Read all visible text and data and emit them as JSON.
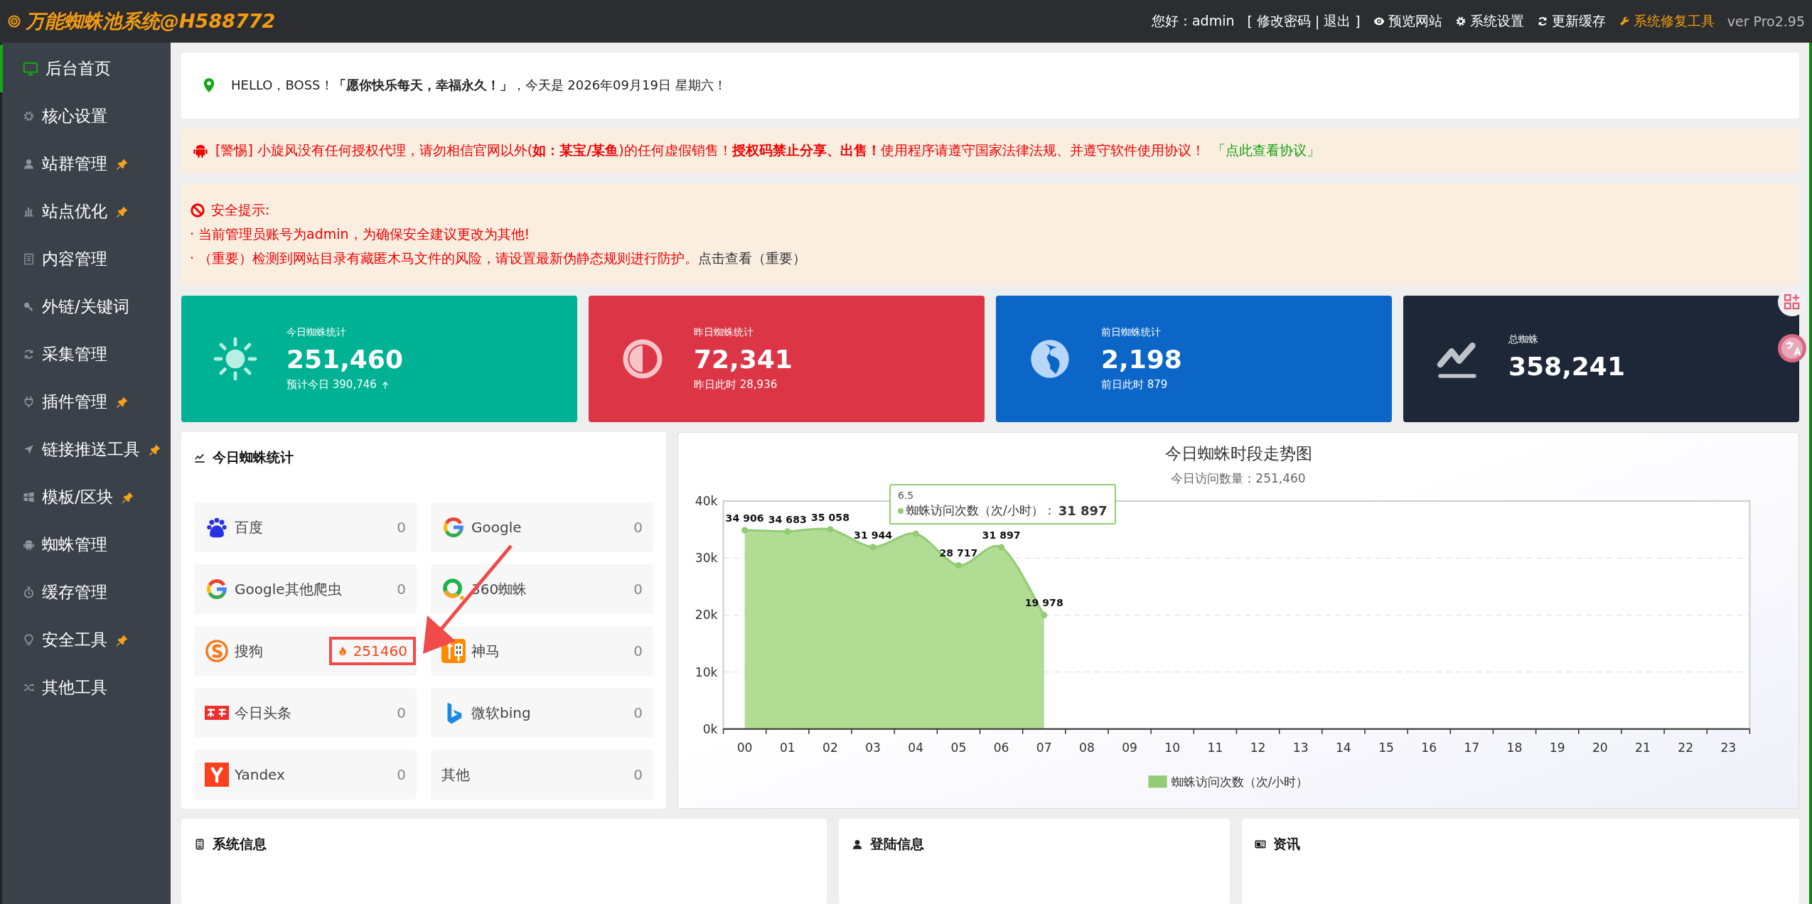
{
  "topbar": {
    "logo": "万能蜘蛛池系统@H588772",
    "greeting": "您好：admin",
    "account_links": {
      "open": "[",
      "items": [
        "修改密码",
        "退出"
      ],
      "separator": "|",
      "close": "]"
    },
    "tools": [
      {
        "label": "预览网站",
        "highlight": false
      },
      {
        "label": "系统设置",
        "highlight": false
      },
      {
        "label": "更新缓存",
        "highlight": false
      },
      {
        "label": "系统修复工具",
        "highlight": true
      }
    ],
    "version": "ver Pro2.95"
  },
  "sidebar": {
    "items": [
      {
        "label": "后台首页",
        "pinned": false,
        "selected": true
      },
      {
        "label": "核心设置",
        "pinned": false,
        "selected": false
      },
      {
        "label": "站群管理",
        "pinned": true,
        "selected": false
      },
      {
        "label": "站点优化",
        "pinned": true,
        "selected": false
      },
      {
        "label": "内容管理",
        "pinned": false,
        "selected": false
      },
      {
        "label": "外链/关键词",
        "pinned": false,
        "selected": false
      },
      {
        "label": "采集管理",
        "pinned": false,
        "selected": false
      },
      {
        "label": "插件管理",
        "pinned": true,
        "selected": false
      },
      {
        "label": "链接推送工具",
        "pinned": true,
        "selected": false
      },
      {
        "label": "模板/区块",
        "pinned": true,
        "selected": false
      },
      {
        "label": "蜘蛛管理",
        "pinned": false,
        "selected": false
      },
      {
        "label": "缓存管理",
        "pinned": false,
        "selected": false
      },
      {
        "label": "安全工具",
        "pinned": true,
        "selected": false
      },
      {
        "label": "其他工具",
        "pinned": false,
        "selected": false
      }
    ]
  },
  "welcome": {
    "text": "HELLO，BOSS！**「愿你快乐每天，幸福永久！」**，今天是 2026年09月19日 星期六！"
  },
  "warning": {
    "text": "[警惕] 小旋风没有任何授权代理，请勿相信官网以外(**如：某宝/某鱼**)的任何虚假销售！**授权码禁止分享、出售！**使用程序请遵守国家法律法规、并遵守软件使用协议！",
    "link": "「点此查看协议」"
  },
  "security": {
    "title": "安全提示:",
    "lines": [
      {
        "text": "· 当前管理员账号为admin，为确保安全建议更改为其他!"
      },
      {
        "text": "· （重要）检测到网站目录有藏匿木马文件的风险，请设置最新伪静态规则进行防护。",
        "link": "点击查看（重要）"
      }
    ]
  },
  "stat_cards": [
    {
      "label": "今日蜘蛛统计",
      "value": "251,460",
      "sub": "预计今日 390,746",
      "trend_up": true,
      "color": "#00b294"
    },
    {
      "label": "昨日蜘蛛统计",
      "value": "72,341",
      "sub": "昨日此时 28,936",
      "trend_up": false,
      "color": "#dc3545"
    },
    {
      "label": "前日蜘蛛统计",
      "value": "2,198",
      "sub": "前日此时 879",
      "trend_up": false,
      "color": "#0b66c8"
    },
    {
      "label": "总蜘蛛",
      "value": "358,241",
      "color": "#1d2738"
    }
  ],
  "spider_stats": {
    "title": "今日蜘蛛统计",
    "items": [
      {
        "name": "百度",
        "count": "0",
        "highlighted": false
      },
      {
        "name": "Google",
        "count": "0",
        "highlighted": false
      },
      {
        "name": "Google其他爬虫",
        "count": "0",
        "highlighted": false
      },
      {
        "name": "360蜘蛛",
        "count": "0",
        "highlighted": false
      },
      {
        "name": "搜狗",
        "count": "251460",
        "highlighted": true
      },
      {
        "name": "神马",
        "count": "0",
        "highlighted": false
      },
      {
        "name": "今日头条",
        "count": "0",
        "highlighted": false
      },
      {
        "name": "微软bing",
        "count": "0",
        "highlighted": false
      },
      {
        "name": "Yandex",
        "count": "0",
        "highlighted": false
      },
      {
        "name": "其他",
        "count": "0",
        "highlighted": false
      }
    ]
  },
  "trend_chart": {
    "subtitle": "今日访问数量：251,460",
    "tooltip": {
      "title": "6.5",
      "series": "蜘蛛访问次数（次/小时）：",
      "value": "31 897"
    },
    "chart_data": {
      "type": "area",
      "title": "今日蜘蛛时段走势图",
      "categories": [
        "00",
        "01",
        "02",
        "03",
        "04",
        "05",
        "06",
        "07",
        "08",
        "09",
        "10",
        "11",
        "12",
        "13",
        "14",
        "15",
        "16",
        "17",
        "18",
        "19",
        "20",
        "21",
        "22",
        "23"
      ],
      "series": [
        {
          "name": "蜘蛛访问次数（次/小时）",
          "color": "#91cc75",
          "values": [
            34906,
            34683,
            35058,
            31944,
            34271,
            28717,
            31897,
            19978,
            null,
            null,
            null,
            null,
            null,
            null,
            null,
            null,
            null,
            null,
            null,
            null,
            null,
            null,
            null,
            null
          ]
        }
      ],
      "ylim": [
        0,
        40000
      ],
      "grid": true,
      "yticks": [
        {
          "value": 0,
          "label": "0k"
        },
        {
          "value": 10000,
          "label": "10k"
        },
        {
          "value": 20000,
          "label": "20k"
        },
        {
          "value": 30000,
          "label": "30k"
        },
        {
          "value": 40000,
          "label": "40k"
        }
      ],
      "value_labels": [
        "34 906",
        "34 683",
        "35 058",
        "31 944",
        null,
        "28 717",
        "31 897",
        "19 978",
        null,
        null,
        null,
        null,
        null,
        null,
        null,
        null,
        null,
        null,
        null,
        null,
        null,
        null,
        null,
        null
      ]
    }
  },
  "bottom_panels": [
    {
      "title": "系统信息"
    },
    {
      "title": "登陆信息"
    },
    {
      "title": "资讯"
    }
  ]
}
